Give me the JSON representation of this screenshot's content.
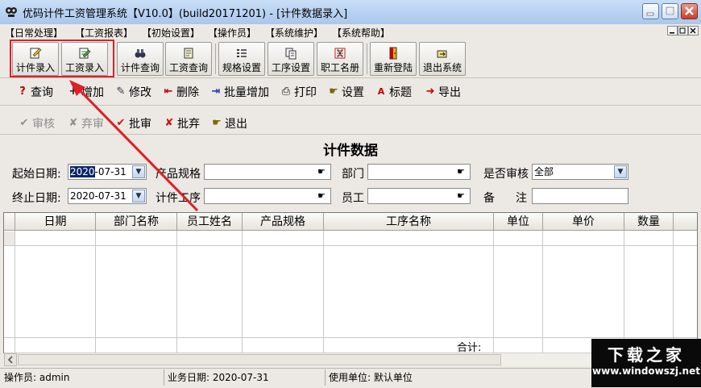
{
  "window": {
    "title": "优码计件工资管理系统【V10.0】(build20171201) - [计件数据录入]"
  },
  "menu": [
    "【日常处理】",
    "【工资报表】",
    "【初始设置】",
    "【操作员】",
    "【系统维护】",
    "【系统帮助】"
  ],
  "toolbar": {
    "buttons": [
      "计件录入",
      "工资录入",
      "计件查询",
      "工资查询",
      "规格设置",
      "工序设置",
      "职工名册",
      "重新登陆",
      "退出系统"
    ]
  },
  "actions_row1": [
    "查询",
    "增加",
    "修改",
    "删除",
    "批量增加",
    "打印",
    "设置",
    "标题",
    "导出"
  ],
  "actions_row2": [
    "审核",
    "弃审",
    "批审",
    "批弃",
    "退出"
  ],
  "form": {
    "title": "计件数据",
    "start_date_label": "起始日期:",
    "start_date_year": "2020",
    "start_date_rest": "-07-31",
    "end_date_label": "终止日期:",
    "end_date": "2020-07-31",
    "product_spec_label": "产品规格",
    "process_label": "计件工序",
    "dept_label": "部门",
    "employee_label": "员工",
    "audited_label": "是否审核",
    "audited_value": "全部",
    "remark_label_a": "备",
    "remark_label_b": "注"
  },
  "table": {
    "columns": [
      "日期",
      "部门名称",
      "员工姓名",
      "产品规格",
      "工序名称",
      "单位",
      "单价",
      "数量"
    ],
    "total_label": "合计:"
  },
  "status": {
    "operator": "操作员: admin",
    "business_date": "业务日期: 2020-07-31",
    "unit": "使用单位: 默认单位"
  },
  "watermark": {
    "line1": "下载之家",
    "line2": "www.windowszj.net"
  }
}
